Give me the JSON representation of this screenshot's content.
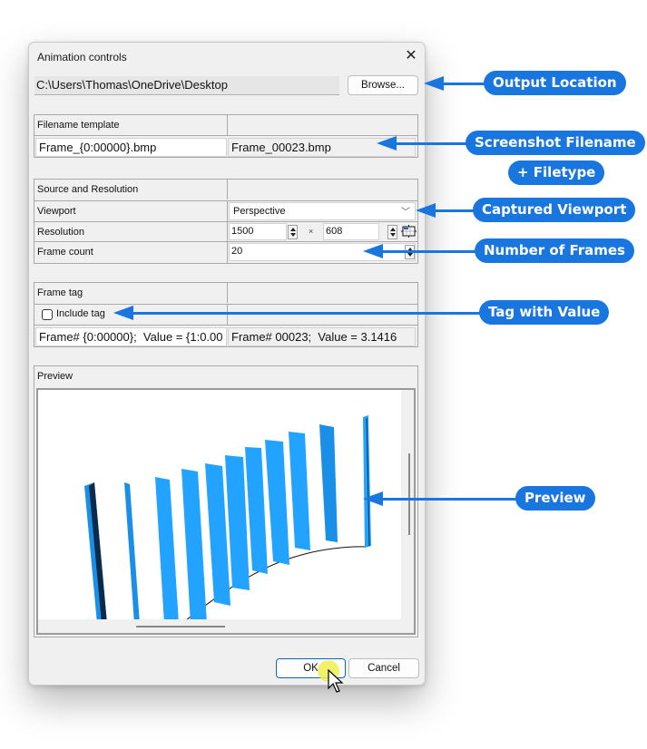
{
  "dialog": {
    "title": "Animation controls",
    "close_icon": "close-icon",
    "output_path": "C:\\Users\\Thomas\\OneDrive\\Desktop",
    "browse_label": "Browse...",
    "filename_group": {
      "header": "Filename template",
      "template_value": "Frame_{0:00000}.bmp",
      "preview_value": "Frame_00023.bmp"
    },
    "source_group": {
      "header": "Source and Resolution",
      "viewport_label": "Viewport",
      "viewport_value": "Perspective",
      "resolution_label": "Resolution",
      "resolution_width": "1500",
      "resolution_sep": "×",
      "resolution_height": "608",
      "frame_count_label": "Frame count",
      "frame_count_value": "20"
    },
    "tag_group": {
      "header": "Frame tag",
      "include_tag_label": "Include tag",
      "include_tag_checked": false,
      "tag_template": "Frame# {0:00000};  Value = {1:0.00",
      "tag_preview": "Frame# 00023;  Value = 3.1416"
    },
    "preview_group": {
      "header": "Preview"
    },
    "ok_label": "OK",
    "cancel_label": "Cancel"
  },
  "annotations": [
    {
      "label": "Output Location"
    },
    {
      "label": "Screenshot Filename"
    },
    {
      "label": "+ Filetype"
    },
    {
      "label": "Captured Viewport"
    },
    {
      "label": "Number of Frames"
    },
    {
      "label": "Tag with Value"
    },
    {
      "label": "Preview"
    }
  ],
  "colors": {
    "accent": "#1876de",
    "bar_blue": "#22a3ff",
    "bar_dark": "#0a2c4a"
  }
}
